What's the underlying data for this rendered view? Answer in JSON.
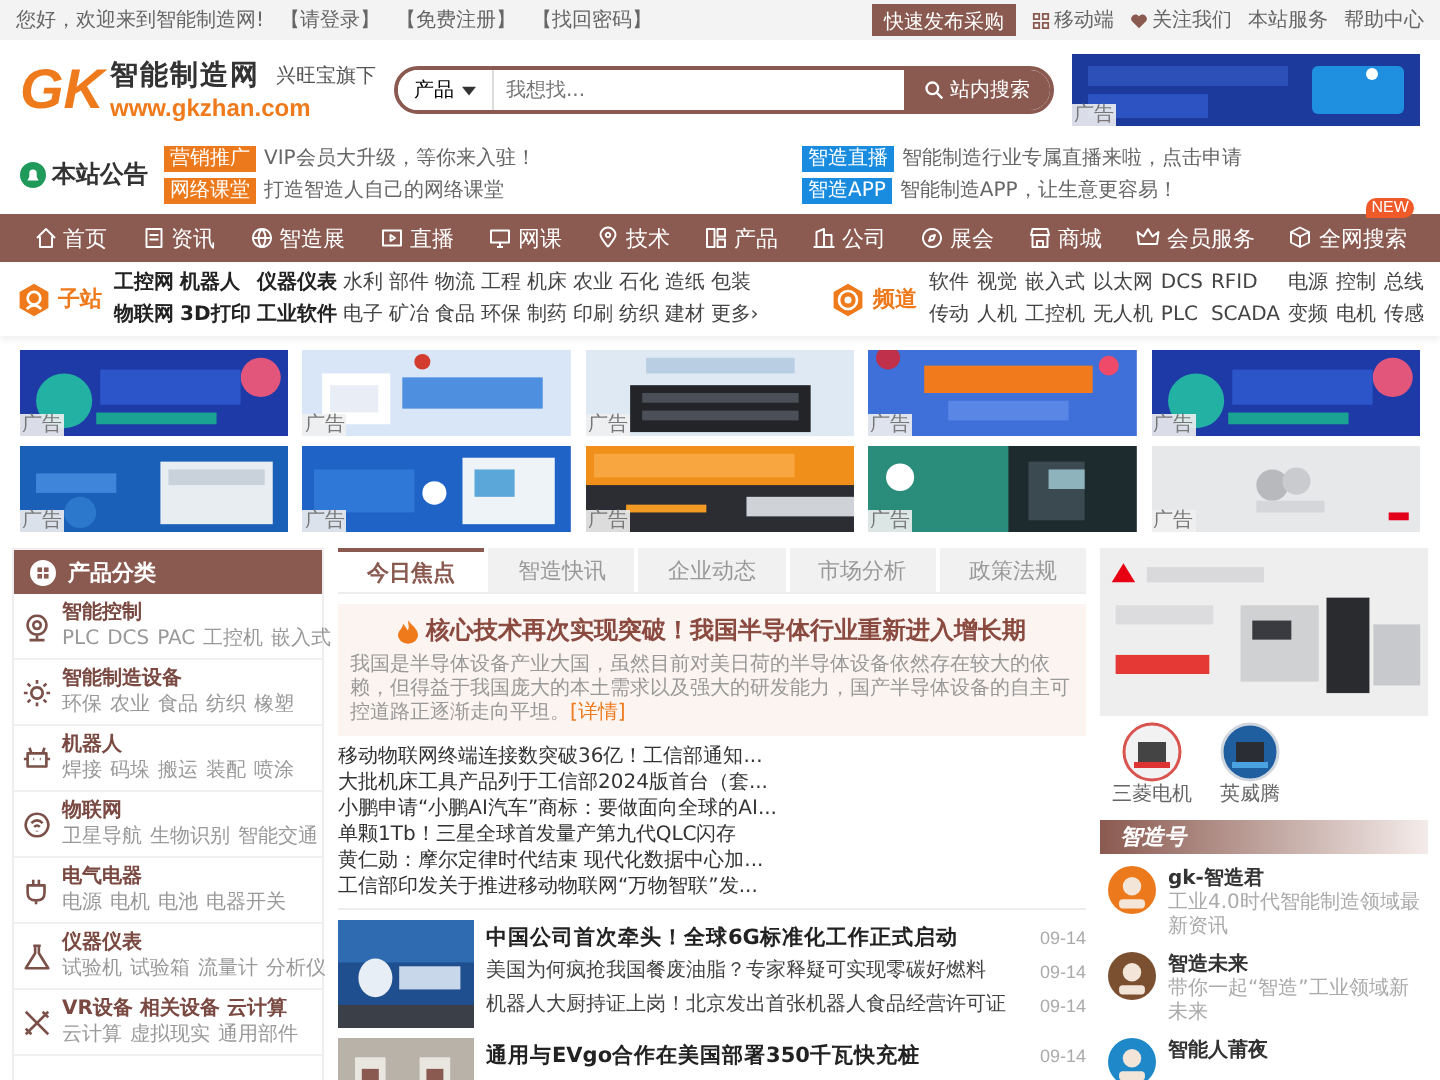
{
  "top_bar": {
    "greeting": "您好，欢迎来到智能制造网!",
    "links": [
      "【请登录】",
      "【免费注册】",
      "【找回密码】"
    ],
    "publish_button": "快速发布采购",
    "right_links": [
      {
        "label": "移动端"
      },
      {
        "label": "关注我们"
      },
      {
        "label": "本站服务"
      },
      {
        "label": "帮助中心"
      }
    ]
  },
  "header": {
    "logo": {
      "mark": "GK",
      "name": "智能制造网",
      "tagline": "兴旺宝旗下",
      "url": "www.gkzhan.com"
    },
    "search": {
      "category": "产品",
      "placeholder": "我想找...",
      "button": "站内搜索"
    },
    "banner": {
      "kind": "picture",
      "tag": "广告"
    }
  },
  "notice": {
    "title": "本站公告",
    "items": [
      {
        "tag": "营销推广",
        "color": "#ec7a1c",
        "text": "VIP会员大升级，等你来入驻！"
      },
      {
        "tag": "智造直播",
        "color": "#1a8ce0",
        "text": "智能制造行业专属直播来啦，点击申请"
      },
      {
        "tag": "网络课堂",
        "color": "#ec7a1c",
        "text": "打造智造人自己的网络课堂"
      },
      {
        "tag": "智造APP",
        "color": "#1a8ce0",
        "text": "智能制造APP，让生意更容易！"
      }
    ]
  },
  "nav": {
    "items": [
      {
        "label": "首页"
      },
      {
        "label": "资讯"
      },
      {
        "label": "智造展"
      },
      {
        "label": "直播"
      },
      {
        "label": "网课"
      },
      {
        "label": "技术"
      },
      {
        "label": "产品"
      },
      {
        "label": "公司"
      },
      {
        "label": "展会"
      },
      {
        "label": "商城"
      },
      {
        "label": "会员服务"
      },
      {
        "label": "全网搜索",
        "badge": "NEW"
      }
    ]
  },
  "subnav": {
    "sites": {
      "title": "子站",
      "links": [
        {
          "label": "工控网",
          "featured": true
        },
        {
          "label": "机器人",
          "featured": true
        },
        {
          "label": "仪器仪表",
          "featured": true
        },
        {
          "label": "水利",
          "featured": false
        },
        {
          "label": "部件",
          "featured": false
        },
        {
          "label": "物流",
          "featured": false
        },
        {
          "label": "工程",
          "featured": false
        },
        {
          "label": "机床",
          "featured": false
        },
        {
          "label": "农业",
          "featured": false
        },
        {
          "label": "石化",
          "featured": false
        },
        {
          "label": "造纸",
          "featured": false
        },
        {
          "label": "包装",
          "featured": false
        },
        {
          "label": "物联网",
          "featured": true
        },
        {
          "label": "3D打印",
          "featured": true
        },
        {
          "label": "工业软件",
          "featured": true
        },
        {
          "label": "电子",
          "featured": false
        },
        {
          "label": "矿冶",
          "featured": false
        },
        {
          "label": "食品",
          "featured": false
        },
        {
          "label": "环保",
          "featured": false
        },
        {
          "label": "制药",
          "featured": false
        },
        {
          "label": "印刷",
          "featured": false
        },
        {
          "label": "纺织",
          "featured": false
        },
        {
          "label": "建材",
          "featured": false
        },
        {
          "label": "更多›",
          "featured": false
        }
      ]
    },
    "channels": {
      "title": "频道",
      "links": [
        "软件",
        "视觉",
        "嵌入式",
        "以太网",
        "DCS",
        "RFID",
        "电源",
        "控制",
        "总线",
        "传动",
        "人机",
        "工控机",
        "无人机",
        "PLC",
        "SCADA",
        "变频",
        "电机",
        "传感"
      ]
    }
  },
  "banners": [
    {
      "kind": "picture",
      "tag": "广告"
    },
    {
      "kind": "picture",
      "tag": "广告"
    },
    {
      "kind": "picture",
      "tag": "广告"
    },
    {
      "kind": "picture",
      "tag": "广告"
    },
    {
      "kind": "picture",
      "tag": "广告"
    },
    {
      "kind": "picture",
      "tag": "广告"
    },
    {
      "kind": "picture",
      "tag": "广告"
    },
    {
      "kind": "picture",
      "tag": "广告"
    },
    {
      "kind": "picture",
      "tag": "广告"
    },
    {
      "kind": "picture",
      "tag": "广告"
    }
  ],
  "sidebar": {
    "title": "产品分类",
    "categories": [
      {
        "name": "智能控制",
        "tags": [
          "PLC",
          "DCS",
          "PAC",
          "工控机",
          "嵌入式"
        ]
      },
      {
        "name": "智能制造设备",
        "tags": [
          "环保",
          "农业",
          "食品",
          "纺织",
          "橡塑"
        ]
      },
      {
        "name": "机器人",
        "tags": [
          "焊接",
          "码垛",
          "搬运",
          "装配",
          "喷涂"
        ]
      },
      {
        "name": "物联网",
        "tags": [
          "卫星导航",
          "生物识别",
          "智能交通"
        ]
      },
      {
        "name": "电气电器",
        "tags": [
          "电源",
          "电机",
          "电池",
          "电器开关"
        ]
      },
      {
        "name": "仪器仪表",
        "tags": [
          "试验机",
          "试验箱",
          "流量计",
          "分析仪"
        ]
      },
      {
        "name": "VR设备 相关设备 云计算",
        "tags": [
          "云计算",
          "虚拟现实",
          "通用部件"
        ]
      }
    ]
  },
  "news": {
    "tabs": [
      {
        "label": "今日焦点",
        "selected": true
      },
      {
        "label": "智造快讯",
        "selected": false
      },
      {
        "label": "企业动态",
        "selected": false
      },
      {
        "label": "市场分析",
        "selected": false
      },
      {
        "label": "政策法规",
        "selected": false
      }
    ],
    "headline": {
      "title": "核心技术再次实现突破！我国半导体行业重新进入增长期",
      "summary": "我国是半导体设备产业大国，虽然目前对美日荷的半导体设备依然存在较大的依赖，但得益于我国庞大的本土需求以及强大的研发能力，国产半导体设备的自主可控道路正逐渐走向平坦。",
      "more": "[详情]"
    },
    "links": [
      "移动物联网终端连接数突破36亿！工信部通知...",
      "大批机床工具产品列于工信部2024版首台（套...",
      "小鹏申请“小鹏AI汽车”商标：要做面向全球的AI...",
      "单颗1Tb！三星全球首发量产第九代QLC闪存",
      "黄仁勋：摩尔定律时代结束 现代化数据中心加...",
      "工信部印发关于推进移动物联网“万物智联”发..."
    ],
    "items": [
      {
        "image": {
          "kind": "picture"
        },
        "rows": [
          {
            "title": "中国公司首次牵头！全球6G标准化工作正式启动",
            "date": "09-14"
          },
          {
            "title": "美国为何疯抢我国餐废油脂？专家释疑可实现零碳好燃料",
            "date": "09-14"
          },
          {
            "title": "机器人大厨持证上岗！北京发出首张机器人食品经营许可证",
            "date": "09-14"
          }
        ]
      },
      {
        "image": {
          "kind": "picture"
        },
        "rows": [
          {
            "title": "通用与EVgo合作在美国部署350千瓦快充桩",
            "date": "09-14"
          }
        ]
      }
    ]
  },
  "promo": {
    "ad": {
      "kind": "picture"
    },
    "brands": [
      {
        "name": "三菱电机",
        "selected": true
      },
      {
        "name": "英威腾",
        "selected": false
      }
    ]
  },
  "zhizao": {
    "title": "智造号",
    "accounts": [
      {
        "name": "gk-智造君",
        "desc": "工业4.0时代智能制造领域最新资讯"
      },
      {
        "name": "智造未来",
        "desc": "带你一起“智造”工业领域新未来"
      },
      {
        "name": "智能人莆夜"
      }
    ]
  }
}
